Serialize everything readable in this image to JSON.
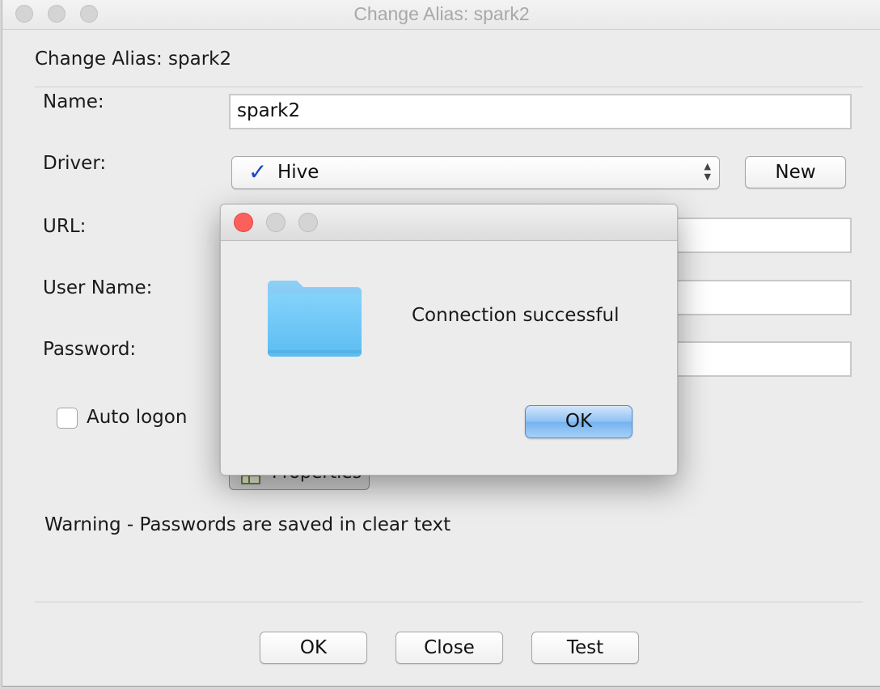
{
  "window": {
    "title": "Change Alias: spark2"
  },
  "form": {
    "heading": "Change Alias: spark2",
    "name_label": "Name:",
    "name_value": "spark2",
    "driver_label": "Driver:",
    "driver_value": "Hive",
    "new_button": "New",
    "url_label": "URL:",
    "url_value": "",
    "username_label": "User Name:",
    "username_value": "",
    "password_label": "Password:",
    "password_value": "",
    "auto_logon_label": "Auto logon",
    "auto_logon_checked": false,
    "properties_button": "Properties",
    "warning": "Warning - Passwords are saved in clear text"
  },
  "footer": {
    "ok_button": "OK",
    "close_button": "Close",
    "test_button": "Test"
  },
  "dialog": {
    "message": "Connection successful",
    "ok_button": "OK",
    "icon": "folder-icon"
  },
  "colors": {
    "close_light": "#fc605b",
    "default_button": "#74b2ef",
    "folder": "#6cc5f6"
  }
}
